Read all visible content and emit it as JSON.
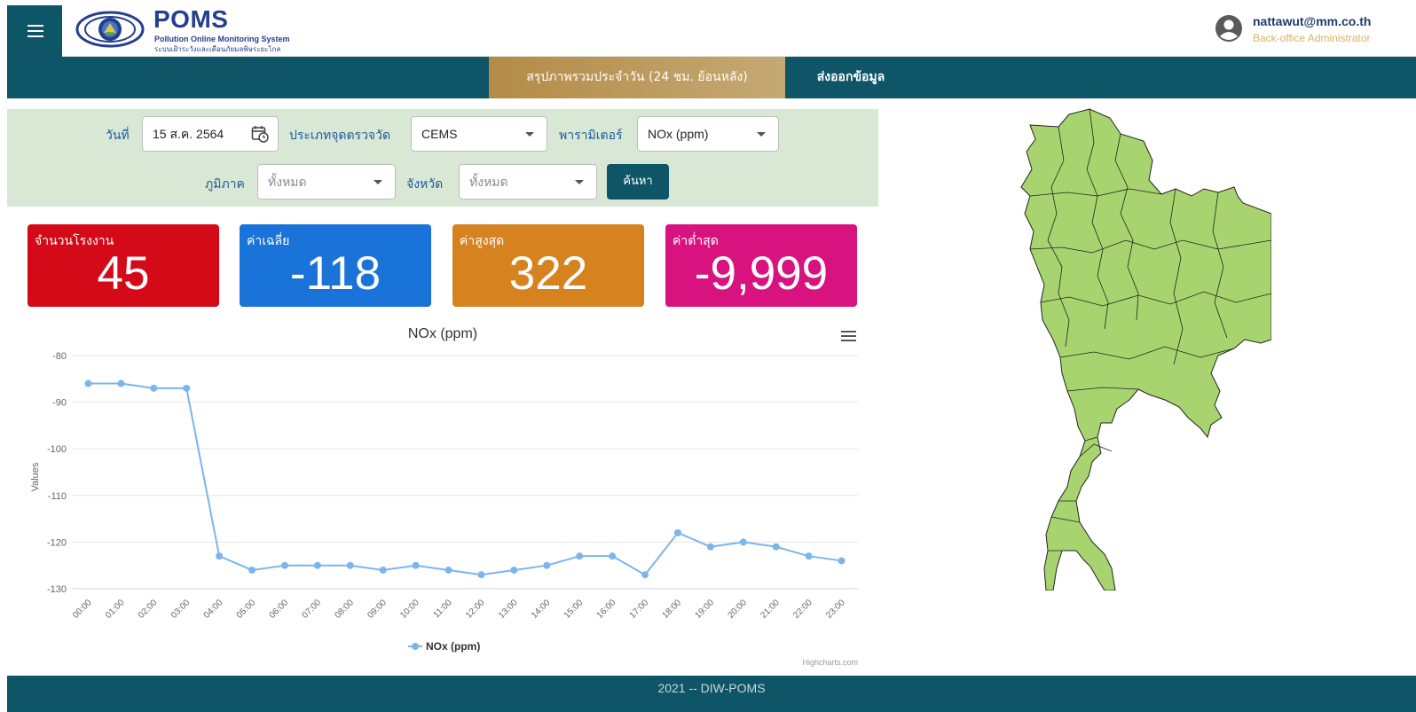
{
  "header": {
    "brand_title": "POMS",
    "brand_subtitle_en": "Pollution Online Monitoring System",
    "brand_subtitle_th": "ระบบเฝ้าระวังและเตือนภัยมลพิษระยะไกล",
    "user_email": "nattawut@mm.co.th",
    "user_role": "Back-office Administrator"
  },
  "nav": {
    "tabs": [
      {
        "label": "สรุปภาพรวมประจำวัน (24 ชม. ย้อนหลัง)",
        "active": true
      },
      {
        "label": "ส่งออกข้อมูล",
        "active": false
      }
    ]
  },
  "filter": {
    "date_label": "วันที่",
    "date_value": "15 ส.ค. 2564",
    "type_label": "ประเภทจุดตรวจวัด",
    "type_value": "CEMS",
    "param_label": "พารามิเตอร์",
    "param_value": "NOx (ppm)",
    "region_label": "ภูมิภาค",
    "region_value": "ทั้งหมด",
    "province_label": "จังหวัด",
    "province_value": "ทั้งหมด",
    "search_label": "ค้นหา"
  },
  "stats": [
    {
      "label": "จำนวนโรงงาน",
      "value": "45",
      "color": "#d50a18"
    },
    {
      "label": "ค่าเฉลี่ย",
      "value": "-118",
      "color": "#1a73d8"
    },
    {
      "label": "ค่าสูงสุด",
      "value": "322",
      "color": "#d6821f"
    },
    {
      "label": "ค่าต่ำสุด",
      "value": "-9,999",
      "color": "#d8127f"
    }
  ],
  "chart_data": {
    "type": "line",
    "title": "NOx (ppm)",
    "xlabel": "",
    "ylabel": "Values",
    "ylim": [
      -130,
      -80
    ],
    "yticks": [
      -80,
      -90,
      -100,
      -110,
      -120,
      -130
    ],
    "categories": [
      "00:00",
      "01:00",
      "02:00",
      "03:00",
      "04:00",
      "05:00",
      "06:00",
      "07:00",
      "08:00",
      "09:00",
      "10:00",
      "11:00",
      "12:00",
      "13:00",
      "14:00",
      "15:00",
      "16:00",
      "17:00",
      "18:00",
      "19:00",
      "20:00",
      "21:00",
      "22:00",
      "23:00"
    ],
    "series": [
      {
        "name": "NOx (ppm)",
        "color": "#7cb5ec",
        "values": [
          -86,
          -86,
          -87,
          -87,
          -123,
          -126,
          -125,
          -125,
          -125,
          -126,
          -125,
          -126,
          -127,
          -126,
          -125,
          -123,
          -123,
          -127,
          -118,
          -121,
          -120,
          -121,
          -123,
          -124
        ]
      }
    ],
    "legend_position": "bottom-center",
    "credits": "Highcharts.com",
    "grid": true
  },
  "footer": {
    "text": "2021 -- DIW-POMS"
  }
}
